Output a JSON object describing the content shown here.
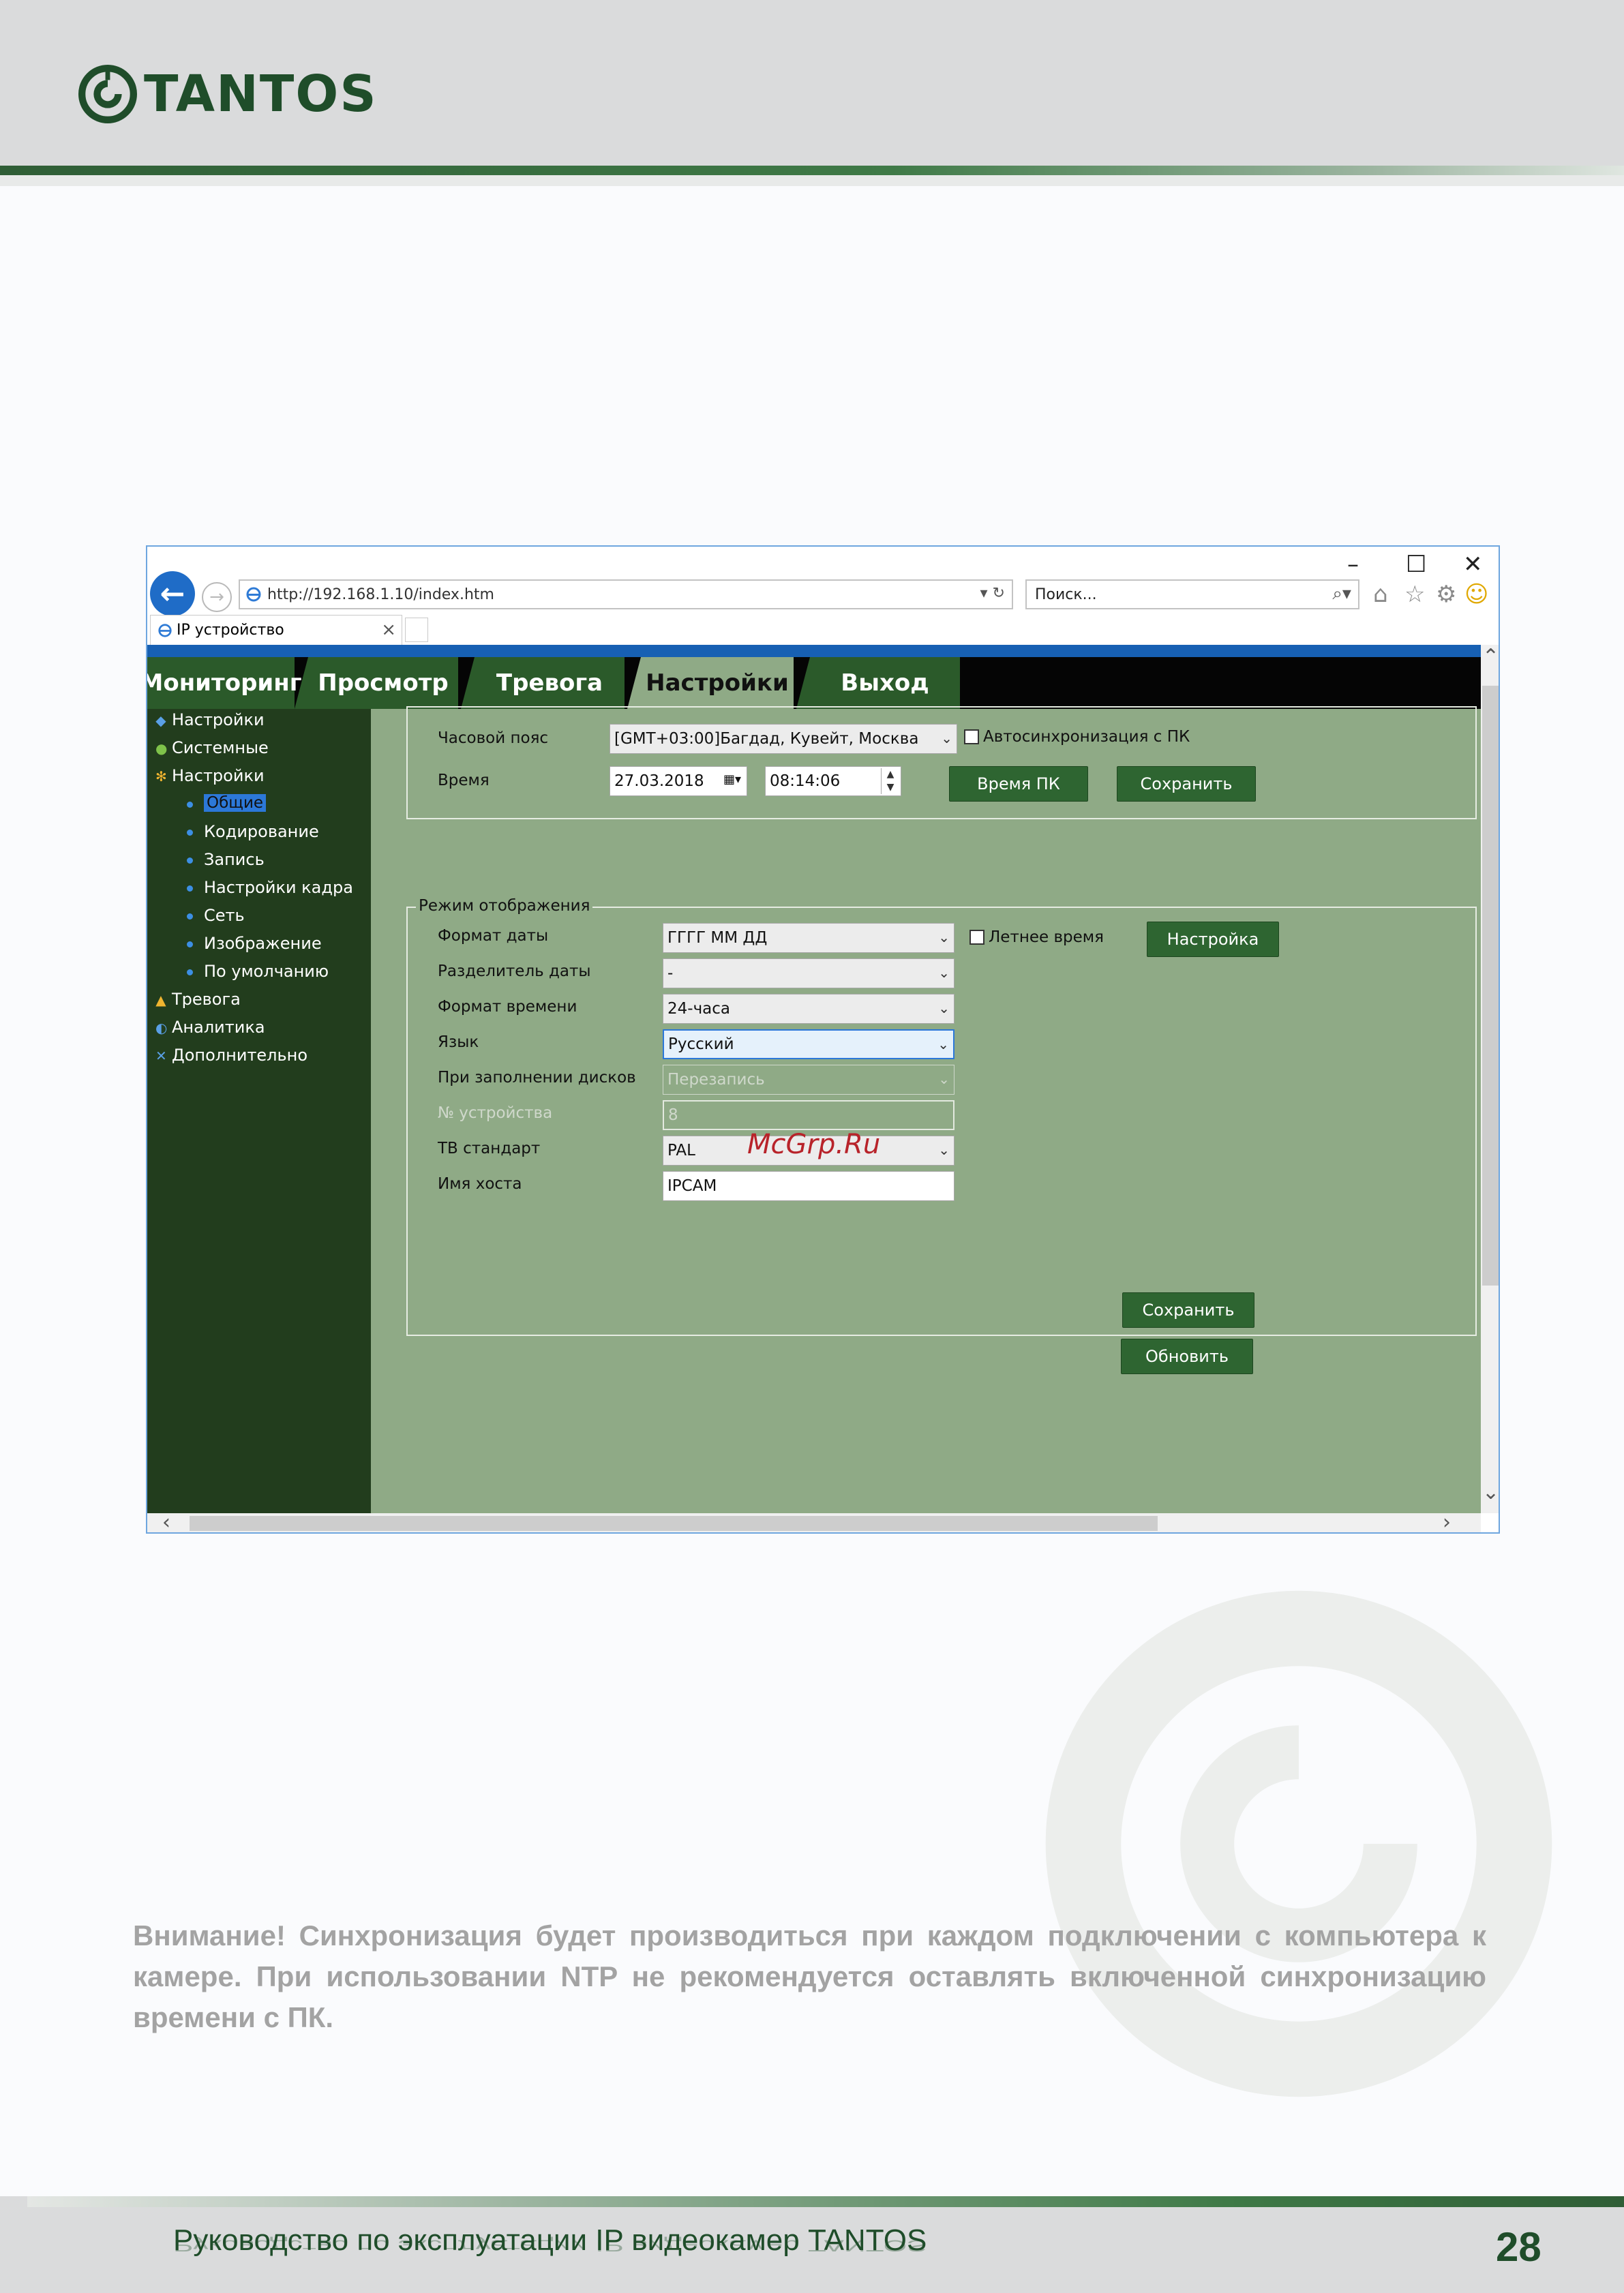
{
  "header": {
    "logo_text": "TANTOS"
  },
  "browser": {
    "window_controls": {
      "minimize": "–",
      "maximize": "☐",
      "close": "✕"
    },
    "address": "http://192.168.1.10/index.htm",
    "search_placeholder": "Поиск...",
    "tab_title": "IP устройство"
  },
  "nav_tabs": [
    {
      "label": "Мониторинг"
    },
    {
      "label": "Просмотр"
    },
    {
      "label": "Тревога"
    },
    {
      "label": "Настройки",
      "active": true
    },
    {
      "label": "Выход"
    }
  ],
  "sidebar": {
    "items": [
      {
        "label": "Настройки",
        "icon": "settings-icon"
      },
      {
        "label": "Системные",
        "icon": "info-icon"
      },
      {
        "label": "Настройки",
        "icon": "gear-icon"
      },
      {
        "label": "Общие",
        "selected": true
      },
      {
        "label": "Кодирование"
      },
      {
        "label": "Запись"
      },
      {
        "label": "Настройки кадра"
      },
      {
        "label": "Сеть"
      },
      {
        "label": "Изображение"
      },
      {
        "label": "По умолчанию"
      },
      {
        "label": "Тревога",
        "icon": "bell-icon"
      },
      {
        "label": "Аналитика",
        "icon": "analytics-icon"
      },
      {
        "label": "Дополнительно",
        "icon": "tools-icon"
      }
    ]
  },
  "time_section": {
    "timezone_label": "Часовой пояс",
    "timezone_value": "[GMT+03:00]Багдад, Кувейт, Москва",
    "autosync_label": "Автосинхронизация с ПК",
    "autosync_checked": false,
    "time_label": "Время",
    "date_value": "27.03.2018",
    "time_value": "08:14:06",
    "pc_time_button": "Время ПК",
    "save_button": "Сохранить"
  },
  "display_section": {
    "legend": "Режим отображения",
    "date_format_label": "Формат даты",
    "date_format_value": "ГГГГ ММ ДД",
    "dst_label": "Летнее время",
    "dst_checked": false,
    "settings_button": "Настройка",
    "date_sep_label": "Разделитель даты",
    "date_sep_value": "-",
    "time_format_label": "Формат времени",
    "time_format_value": "24-часа",
    "lang_label": "Язык",
    "lang_value": "Русский",
    "disk_full_label": "При заполнении дисков",
    "disk_full_value": "Перезапись",
    "device_no_label": "№ устройства",
    "device_no_value": "8",
    "tv_label": "ТВ стандарт",
    "tv_value": "PAL",
    "host_label": "Имя хоста",
    "host_value": "IPCAM",
    "save_button": "Сохранить",
    "refresh_button": "Обновить"
  },
  "watermark": "McGrp.Ru",
  "note": "Внимание! Синхронизация будет производиться при каждом подключении с компьютера к камере. При использовании NTP не рекомендуется оставлять включенной синхронизацию времени с ПК.",
  "footer": {
    "title": "Руководство по эксплуатации IP видеокамер TANTOS",
    "page_number": "28"
  },
  "colors": {
    "brand_green": "#1f4d2a",
    "panel_bg": "#8faa86",
    "sidebar_bg": "#223d1d",
    "button_green": "#2e6531"
  }
}
